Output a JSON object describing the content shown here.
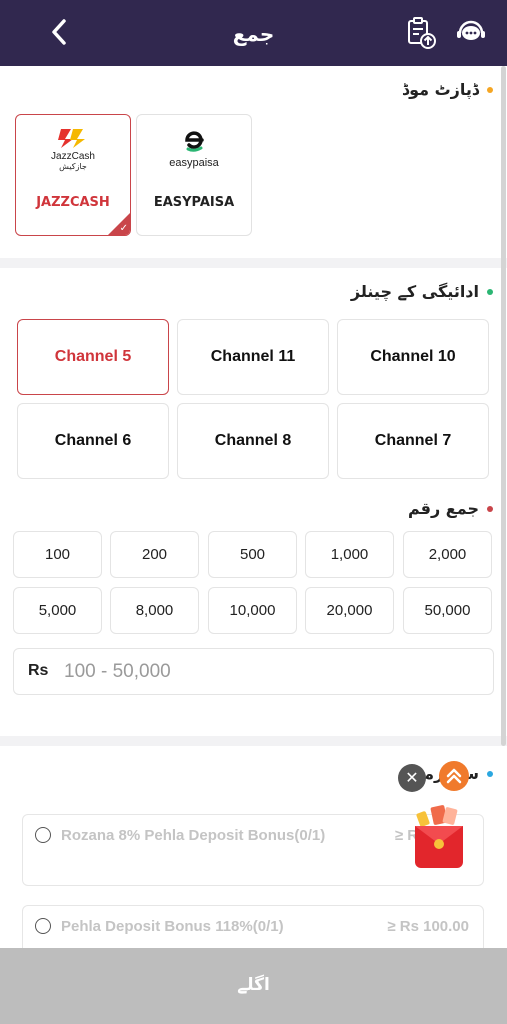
{
  "header": {
    "title": "جمع",
    "icons": [
      "back-chevron-icon",
      "deposit-history-icon",
      "support-chat-icon"
    ]
  },
  "deposit_mode": {
    "title": "ڈپازٹ موڈ",
    "dot_color": "#f5a623",
    "options": [
      {
        "label": "JAZZCASH",
        "logo_text": "JazzCash",
        "logo_subtext": "جازکیش",
        "selected": true
      },
      {
        "label": "EASYPAISA",
        "logo_text": "easypaisa",
        "selected": false
      }
    ]
  },
  "channels": {
    "title": "ادائیگی کے چینلز",
    "dot_color": "#2bb673",
    "items": [
      {
        "label": "Channel 5",
        "selected": true
      },
      {
        "label": "Channel 11",
        "selected": false
      },
      {
        "label": "Channel 10",
        "selected": false
      },
      {
        "label": "Channel 6",
        "selected": false
      },
      {
        "label": "Channel 8",
        "selected": false
      },
      {
        "label": "Channel 7",
        "selected": false
      }
    ]
  },
  "amount": {
    "title": "جمع رقم",
    "dot_color": "#c9454a",
    "presets": [
      "100",
      "200",
      "500",
      "1,000",
      "2,000",
      "5,000",
      "8,000",
      "10,000",
      "20,000",
      "50,000"
    ],
    "currency_label": "Rs",
    "input_placeholder": "100 - 50,000",
    "input_value": ""
  },
  "activity": {
    "title": "سرگرمی",
    "dot_color": "#2aa7e0",
    "bonuses": [
      {
        "name": "Rozana 8% Pehla Deposit Bonus(0/1)",
        "amount": "≥ Rs 1",
        "selected": false
      },
      {
        "name": "Pehla Deposit Bonus 118%(0/1)",
        "amount": "≥ Rs 100.00",
        "selected": false
      }
    ]
  },
  "footer": {
    "next_label": "اگلے"
  },
  "colors": {
    "header_bg": "#31284f",
    "accent_red": "#c9454a",
    "footer_bg": "#bdbdbd"
  }
}
